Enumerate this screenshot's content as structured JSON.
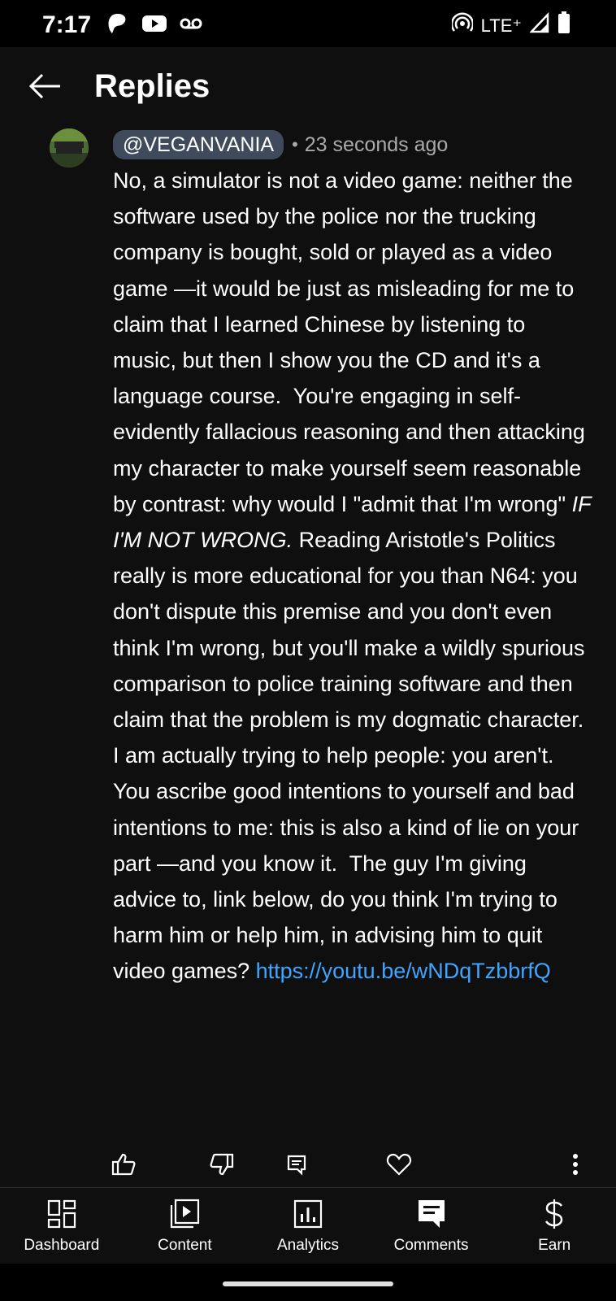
{
  "status_bar": {
    "time": "7:17",
    "network": "LTE⁺",
    "icons": [
      "pinwheel-icon",
      "youtube-icon",
      "voicemail-icon",
      "hotspot-icon",
      "signal-icon",
      "battery-icon"
    ]
  },
  "header": {
    "title": "Replies",
    "back_icon": "arrow-left-icon"
  },
  "comment": {
    "avatar_text": "Vegan Vania",
    "handle": "@VEGANVANIA",
    "separator": "•",
    "timestamp": "23 seconds ago",
    "body_1": "No, a simulator is not a video game: neither the software used by the police nor the trucking company is bought, sold or played as a video game —it would be just as misleading for me to claim that I learned Chinese by listening to music, but then I show you the CD and it's a language course.  You're engaging in self-evidently fallacious reasoning and then attacking my character to make yourself seem reasonable by contrast: why would I \"admit that I'm wrong\" ",
    "body_emphasis": "IF I'M NOT WRONG.",
    "body_2": " Reading Aristotle's Politics really is more educational for you than N64: you don't dispute this premise and you don't even think I'm wrong, but you'll make a wildly spurious comparison to police training software and then claim that the problem is my dogmatic character.  I am actually trying to help people: you aren't.  You ascribe good intentions to yourself and bad intentions to me: this is also a kind of lie on your part —and you know it.  The guy I'm giving advice to, link below, do you think I'm trying to harm him or help him, in advising him to quit video games? ",
    "link": "https://youtu.be/wNDqTzbbrfQ"
  },
  "actions": {
    "like_icon": "thumbs-up-icon",
    "dislike_icon": "thumbs-down-icon",
    "reply_icon": "reply-icon",
    "heart_icon": "heart-icon",
    "more_icon": "more-vert-icon"
  },
  "bottom_nav": {
    "items": [
      {
        "label": "Dashboard",
        "icon": "dashboard-icon"
      },
      {
        "label": "Content",
        "icon": "content-icon"
      },
      {
        "label": "Analytics",
        "icon": "analytics-icon"
      },
      {
        "label": "Comments",
        "icon": "comments-icon",
        "active": true
      },
      {
        "label": "Earn",
        "icon": "dollar-icon"
      }
    ]
  },
  "colors": {
    "background": "#0f0f0f",
    "link": "#3ea6ff",
    "handle_chip": "#3f4b5c",
    "muted": "#aaaaaa"
  }
}
